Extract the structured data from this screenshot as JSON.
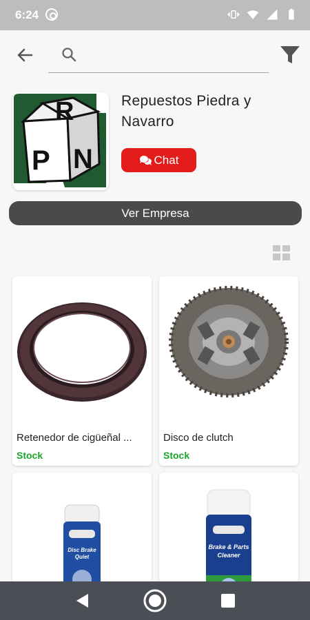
{
  "status_bar": {
    "time": "6:24",
    "left_icon": "at-sign-icon",
    "right_icons": [
      "vibrate-icon",
      "wifi-icon",
      "signal-icon",
      "battery-icon"
    ]
  },
  "app_bar": {
    "back_icon": "arrow-left-icon",
    "search_icon": "search-icon",
    "search_value": "",
    "filter_icon": "filter-icon"
  },
  "company": {
    "name": "Repuestos Piedra y Navarro",
    "logo_letters": [
      "R",
      "P",
      "N"
    ],
    "chat_label": "Chat",
    "chat_icon": "chat-bubbles-icon",
    "ver_empresa_label": "Ver Empresa"
  },
  "view_toggle_icon": "grid-view-icon",
  "products": [
    {
      "name": "Retenedor de cigüeñal ...",
      "stock": "Stock",
      "image": "oil-seal-ring"
    },
    {
      "name": "Disco de clutch",
      "stock": "Stock",
      "image": "clutch-disc"
    },
    {
      "name": "",
      "stock": "",
      "image": "brake-spray-can",
      "can_label": [
        "Disc Brake",
        "Quiet"
      ]
    },
    {
      "name": "",
      "stock": "",
      "image": "brake-cleaner-can",
      "can_label": [
        "Brake & Parts",
        "Cleaner"
      ]
    }
  ],
  "colors": {
    "chat_button": "#e21b1b",
    "ver_empresa_button": "#4a4a4a",
    "stock_text": "#1aa52a",
    "logo_green": "#1f5a30",
    "nav_bar": "#4b4f55",
    "status_bar": "#bdbdbd"
  },
  "nav_bar": {
    "icons": [
      "nav-back-icon",
      "nav-home-icon",
      "nav-recents-icon"
    ]
  }
}
